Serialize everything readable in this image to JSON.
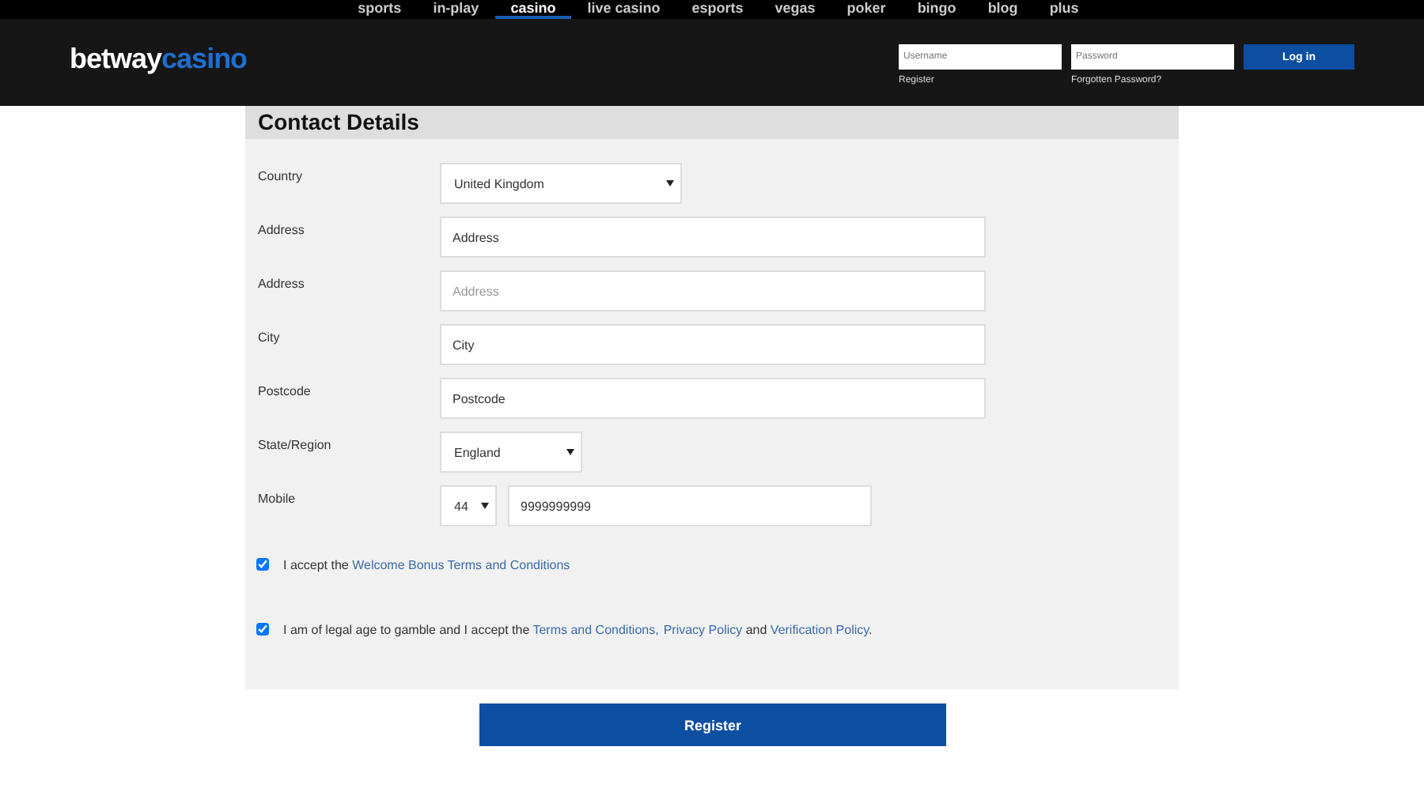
{
  "nav": [
    {
      "label": "sports",
      "selected": false
    },
    {
      "label": "in-play",
      "selected": false
    },
    {
      "label": "casino",
      "selected": true
    },
    {
      "label": "live casino",
      "selected": false
    },
    {
      "label": "esports",
      "selected": false
    },
    {
      "label": "vegas",
      "selected": false
    },
    {
      "label": "poker",
      "selected": false
    },
    {
      "label": "bingo",
      "selected": false
    },
    {
      "label": "blog",
      "selected": false
    },
    {
      "label": "plus",
      "selected": false
    }
  ],
  "logo": {
    "primary": "betway",
    "secondary": "casino"
  },
  "login": {
    "username": {
      "placeholder": "Username"
    },
    "password": {
      "placeholder": "Password"
    },
    "button": "Log in",
    "register": "Register",
    "forgot": "Forgotten Password?"
  },
  "form": {
    "title": "Contact Details",
    "fields": [
      {
        "kind": "select",
        "label": "Country",
        "value": "United Kingdom"
      },
      {
        "kind": "text",
        "label": "Address",
        "value": "Address"
      },
      {
        "kind": "text",
        "label": "Address",
        "placeholder": "Address"
      },
      {
        "kind": "text",
        "label": "City",
        "value": "City"
      },
      {
        "kind": "text",
        "label": "Postcode",
        "value": "Postcode"
      },
      {
        "kind": "short-select",
        "label": "State/Region",
        "value": "England"
      },
      {
        "kind": "phone",
        "label": "Mobile",
        "code": "44",
        "value": "9999999999"
      }
    ],
    "agreements": [
      {
        "checked": true,
        "parts": [
          {
            "kind": "text",
            "text": "I accept the "
          },
          {
            "kind": "link",
            "text": "Welcome Bonus Terms and Conditions"
          }
        ]
      },
      {
        "checked": true,
        "parts": [
          {
            "kind": "text",
            "text": "I am of legal age to gamble and I accept the "
          },
          {
            "kind": "link",
            "text": "Terms and Conditions,"
          },
          {
            "kind": "link",
            "text": "Privacy Policy"
          },
          {
            "kind": "text",
            "text": " and "
          },
          {
            "kind": "link",
            "text": "Verification Policy"
          },
          {
            "kind": "text",
            "text": "."
          }
        ]
      }
    ]
  },
  "submit": "Register"
}
